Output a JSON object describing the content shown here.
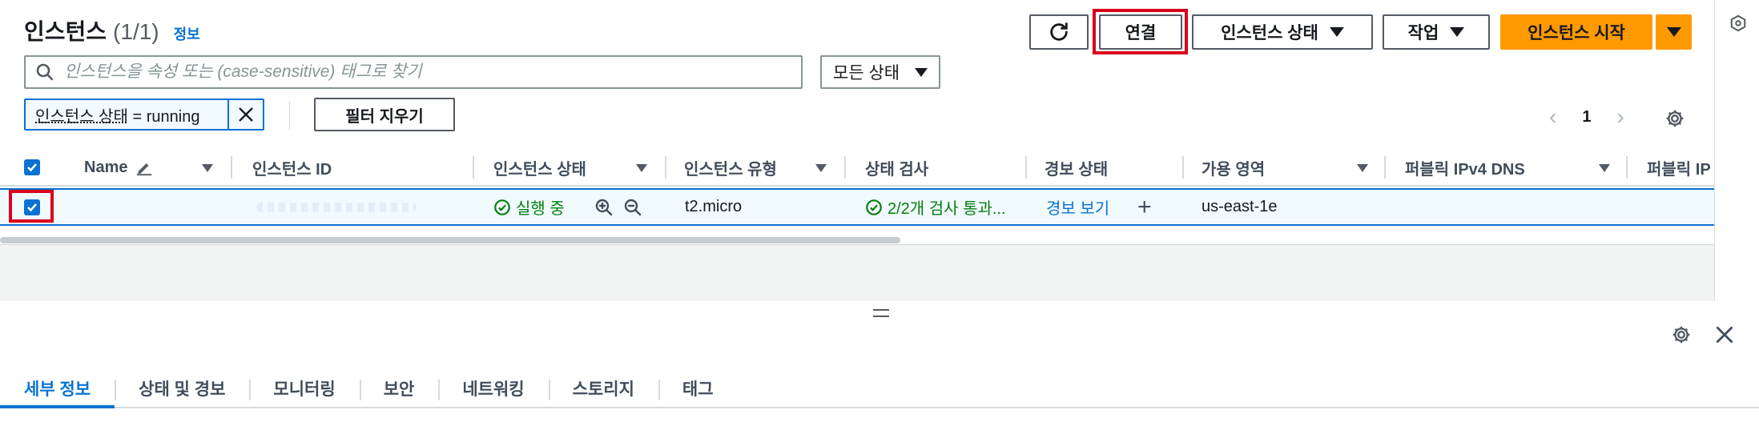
{
  "header": {
    "title": "인스턴스",
    "count": "(1/1)",
    "info_link": "정보"
  },
  "toolbar": {
    "connect_label": "연결",
    "instance_state_label": "인스턴스 상태",
    "actions_label": "작업",
    "launch_label": "인스턴스 시작"
  },
  "search": {
    "placeholder": "인스턴스을 속성 또는 (case-sensitive) 태그로 찾기"
  },
  "state_filter": {
    "selected": "모든 상태"
  },
  "filter_token": {
    "key": "인스턴스 상태",
    "rest": " = running"
  },
  "clear_filters_label": "필터 지우기",
  "pagination": {
    "current_page": "1",
    "prev": "‹",
    "next": "›"
  },
  "table": {
    "columns": {
      "name": "Name",
      "instance_id": "인스턴스 ID",
      "instance_state": "인스턴스 상태",
      "instance_type": "인스턴스 유형",
      "status_check": "상태 검사",
      "alarm_status": "경보 상태",
      "availability_zone": "가용 영역",
      "public_dns": "퍼블릭 IPv4 DNS",
      "public_ip": "퍼블릭 IP"
    },
    "rows": [
      {
        "name": "",
        "instance_id": "",
        "state": "실행 중",
        "type": "t2.micro",
        "status_check": "2/2개 검사 통과...",
        "alarm_link": "경보 보기",
        "alarm_add": "+",
        "az": "us-east-1e"
      }
    ]
  },
  "details_panel": {
    "tabs": [
      "세부 정보",
      "상태 및 경보",
      "모니터링",
      "보안",
      "네트워킹",
      "스토리지",
      "태그"
    ],
    "active_tab": 0
  },
  "colors": {
    "primary": "#ff9900",
    "link": "#0972d3",
    "success": "#037f0c",
    "highlight": "#d9001b"
  }
}
